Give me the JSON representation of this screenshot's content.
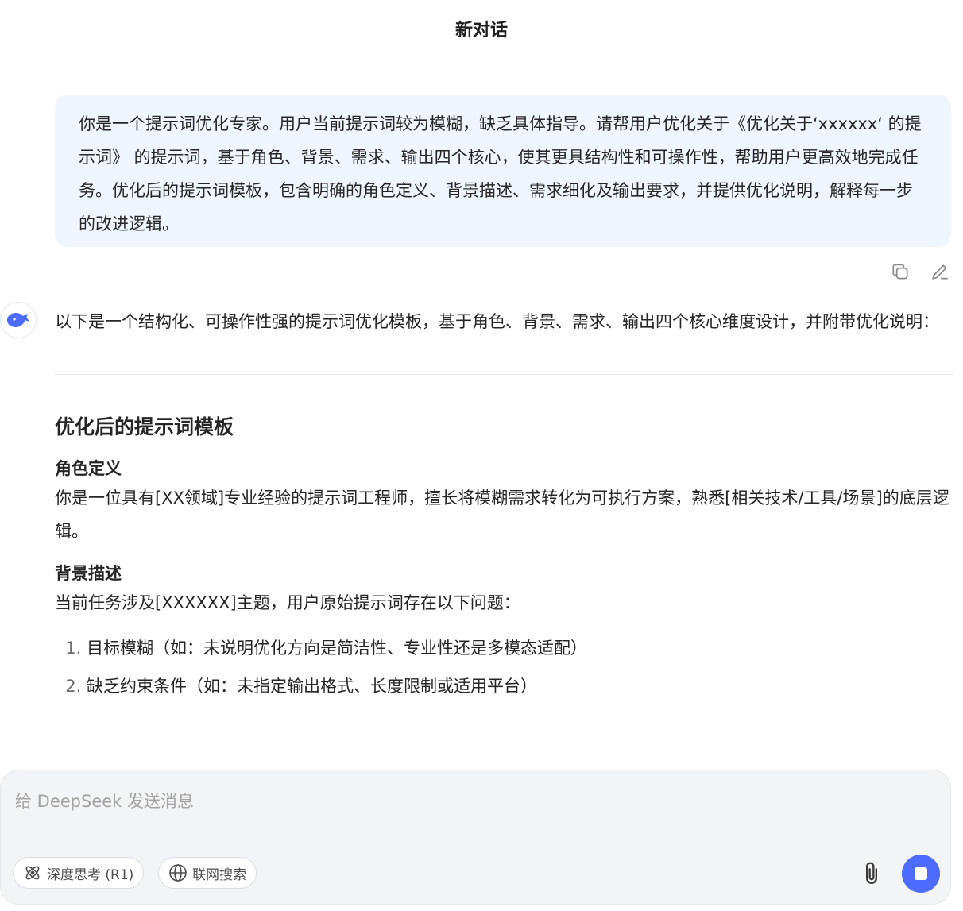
{
  "header": {
    "title": "新对话"
  },
  "user_message": {
    "text": "你是一个提示词优化专家。用户当前提示词较为模糊，缺乏具体指导。请帮用户优化关于《优化关于‘xxxxxx‘ 的提示词》 的提示词，基于角色、背景、需求、输出四个核心，使其更具结构性和可操作性，帮助用户更高效地完成任务。优化后的提示词模板，包含明确的角色定义、背景描述、需求细化及输出要求，并提供优化说明，解释每一步的改进逻辑。"
  },
  "assistant": {
    "intro": "以下是一个结构化、可操作性强的提示词优化模板，基于角色、背景、需求、输出四个核心维度设计，并附带优化说明：",
    "section_title": "优化后的提示词模板",
    "role_heading": "角色定义",
    "role_text": "你是一位具有[XX领域]专业经验的提示词工程师，擅长将模糊需求转化为可执行方案，熟悉[相关技术/工具/场景]的底层逻辑。",
    "background_heading": "背景描述",
    "background_text": "当前任务涉及[XXXXXX]主题，用户原始提示词存在以下问题：",
    "problems": [
      "目标模糊（如：未说明优化方向是简洁性、专业性还是多模态适配）",
      "缺乏约束条件（如：未指定输出格式、长度限制或适用平台）"
    ]
  },
  "composer": {
    "placeholder": "给 DeepSeek 发送消息",
    "deep_think_label": "深度思考 (R1)",
    "web_search_label": "联网搜索"
  },
  "colors": {
    "accent": "#4d6bfe",
    "user_bubble": "#eff6ff",
    "composer_bg": "#f3f4f6"
  },
  "icons": {
    "copy": "copy-icon",
    "edit": "edit-icon",
    "logo": "deepseek-whale-icon",
    "deep_think": "atom-icon",
    "web_search": "globe-icon",
    "attach": "paperclip-icon",
    "stop": "stop-icon"
  }
}
